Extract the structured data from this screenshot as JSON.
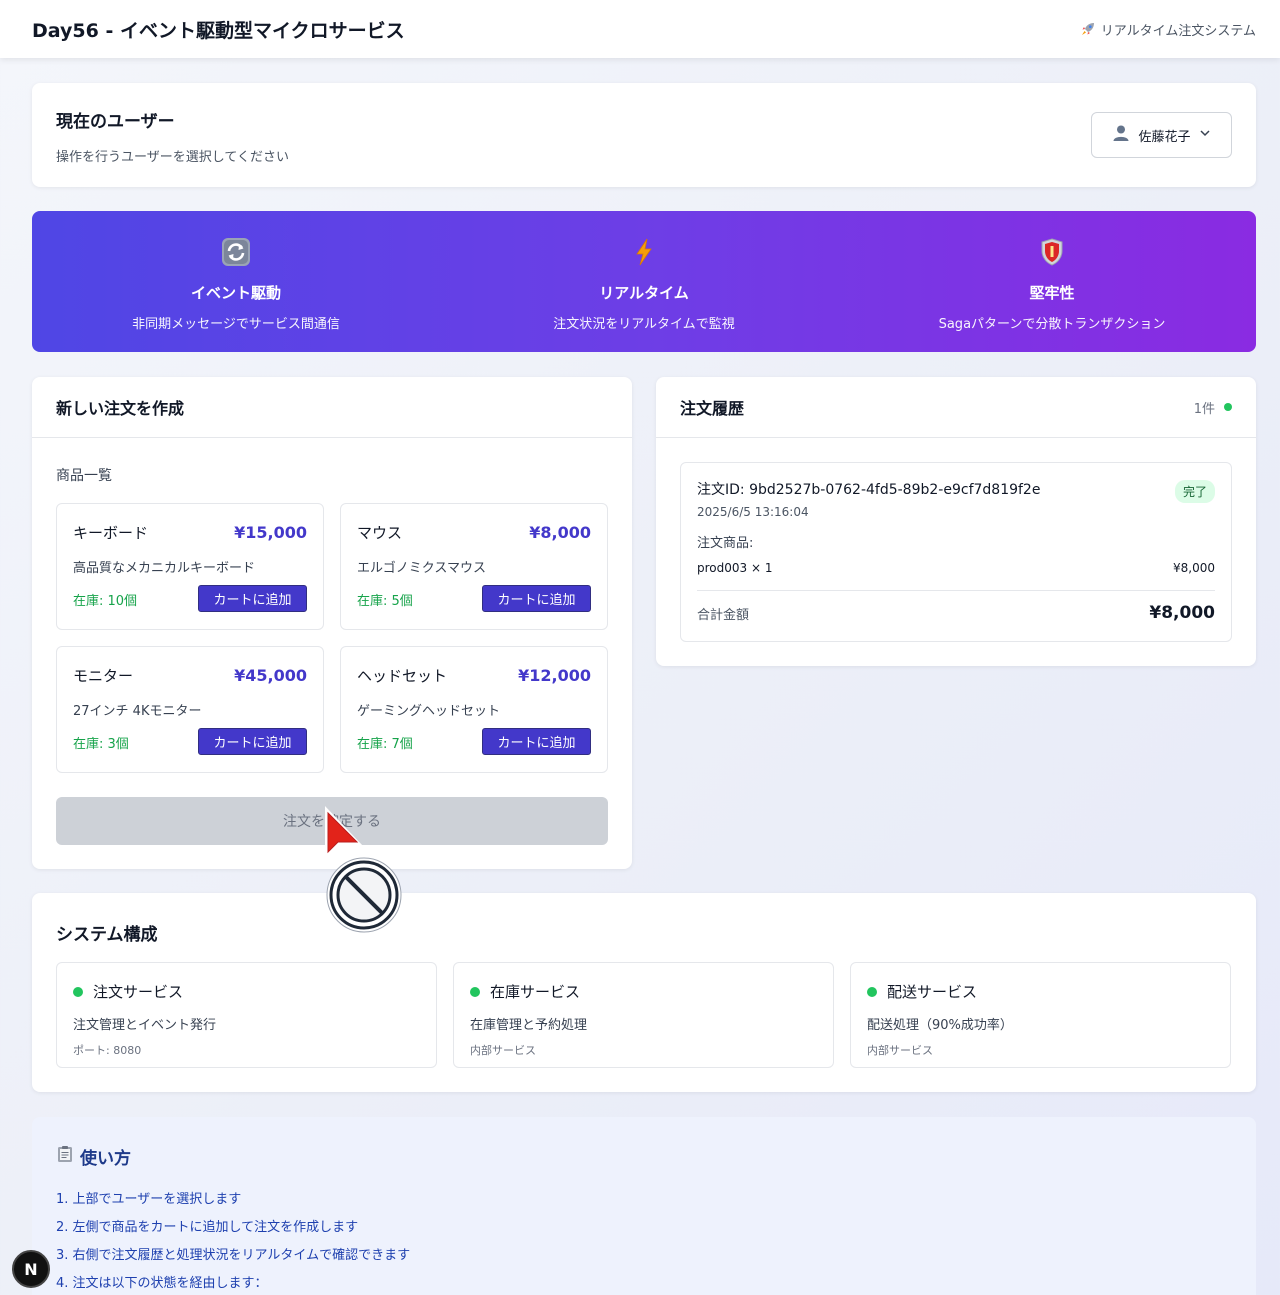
{
  "header": {
    "title": "Day56 - イベント駆動型マイクロサービス",
    "subtitle": "リアルタイム注文システム",
    "subtitle_icon": "rocket-icon"
  },
  "user": {
    "title": "現在のユーザー",
    "description": "操作を行うユーザーを選択してください",
    "selected": "佐藤花子"
  },
  "features": [
    {
      "icon": "refresh-icon",
      "title": "イベント駆動",
      "desc": "非同期メッセージでサービス間通信"
    },
    {
      "icon": "lightning-icon",
      "title": "リアルタイム",
      "desc": "注文状況をリアルタイムで監視"
    },
    {
      "icon": "shield-icon",
      "title": "堅牢性",
      "desc": "Sagaパターンで分散トランザクション"
    }
  ],
  "new_order": {
    "title": "新しい注文を作成",
    "products_label": "商品一覧",
    "add_label": "カートに追加",
    "confirm_label": "注文を確定する",
    "products": [
      {
        "name": "キーボード",
        "price": "¥15,000",
        "desc": "高品質なメカニカルキーボード",
        "stock": "在庫: 10個"
      },
      {
        "name": "マウス",
        "price": "¥8,000",
        "desc": "エルゴノミクスマウス",
        "stock": "在庫: 5個"
      },
      {
        "name": "モニター",
        "price": "¥45,000",
        "desc": "27インチ 4Kモニター",
        "stock": "在庫: 3個"
      },
      {
        "name": "ヘッドセット",
        "price": "¥12,000",
        "desc": "ゲーミングヘッドセット",
        "stock": "在庫: 7個"
      }
    ]
  },
  "history": {
    "title": "注文履歴",
    "count": "1件",
    "orders": [
      {
        "id": "注文ID: 9bd2527b-0762-4fd5-89b2-e9cf7d819f2e",
        "date": "2025/6/5 13:16:04",
        "status": "完了",
        "items_label": "注文商品:",
        "item": "prod003 × 1",
        "item_price": "¥8,000",
        "total_label": "合計金額",
        "total": "¥8,000"
      }
    ]
  },
  "system": {
    "title": "システム構成",
    "services": [
      {
        "name": "注文サービス",
        "desc": "注文管理とイベント発行",
        "note": "ポート: 8080"
      },
      {
        "name": "在庫サービス",
        "desc": "在庫管理と予約処理",
        "note": "内部サービス"
      },
      {
        "name": "配送サービス",
        "desc": "配送処理（90%成功率）",
        "note": "内部サービス"
      }
    ]
  },
  "howto": {
    "title": "使い方",
    "steps": [
      "1. 上部でユーザーを選択します",
      "2. 左側で商品をカートに追加して注文を作成します",
      "3. 右側で注文履歴と処理状況をリアルタイムで確認できます",
      "4. 注文は以下の状態を経由します："
    ]
  },
  "dev_badge": "N",
  "colors": {
    "accent": "#4338ca",
    "stock": "#16a34a",
    "status_dot": "#22c55e",
    "banner_start": "#4f46e5",
    "banner_end": "#8a2be2"
  }
}
